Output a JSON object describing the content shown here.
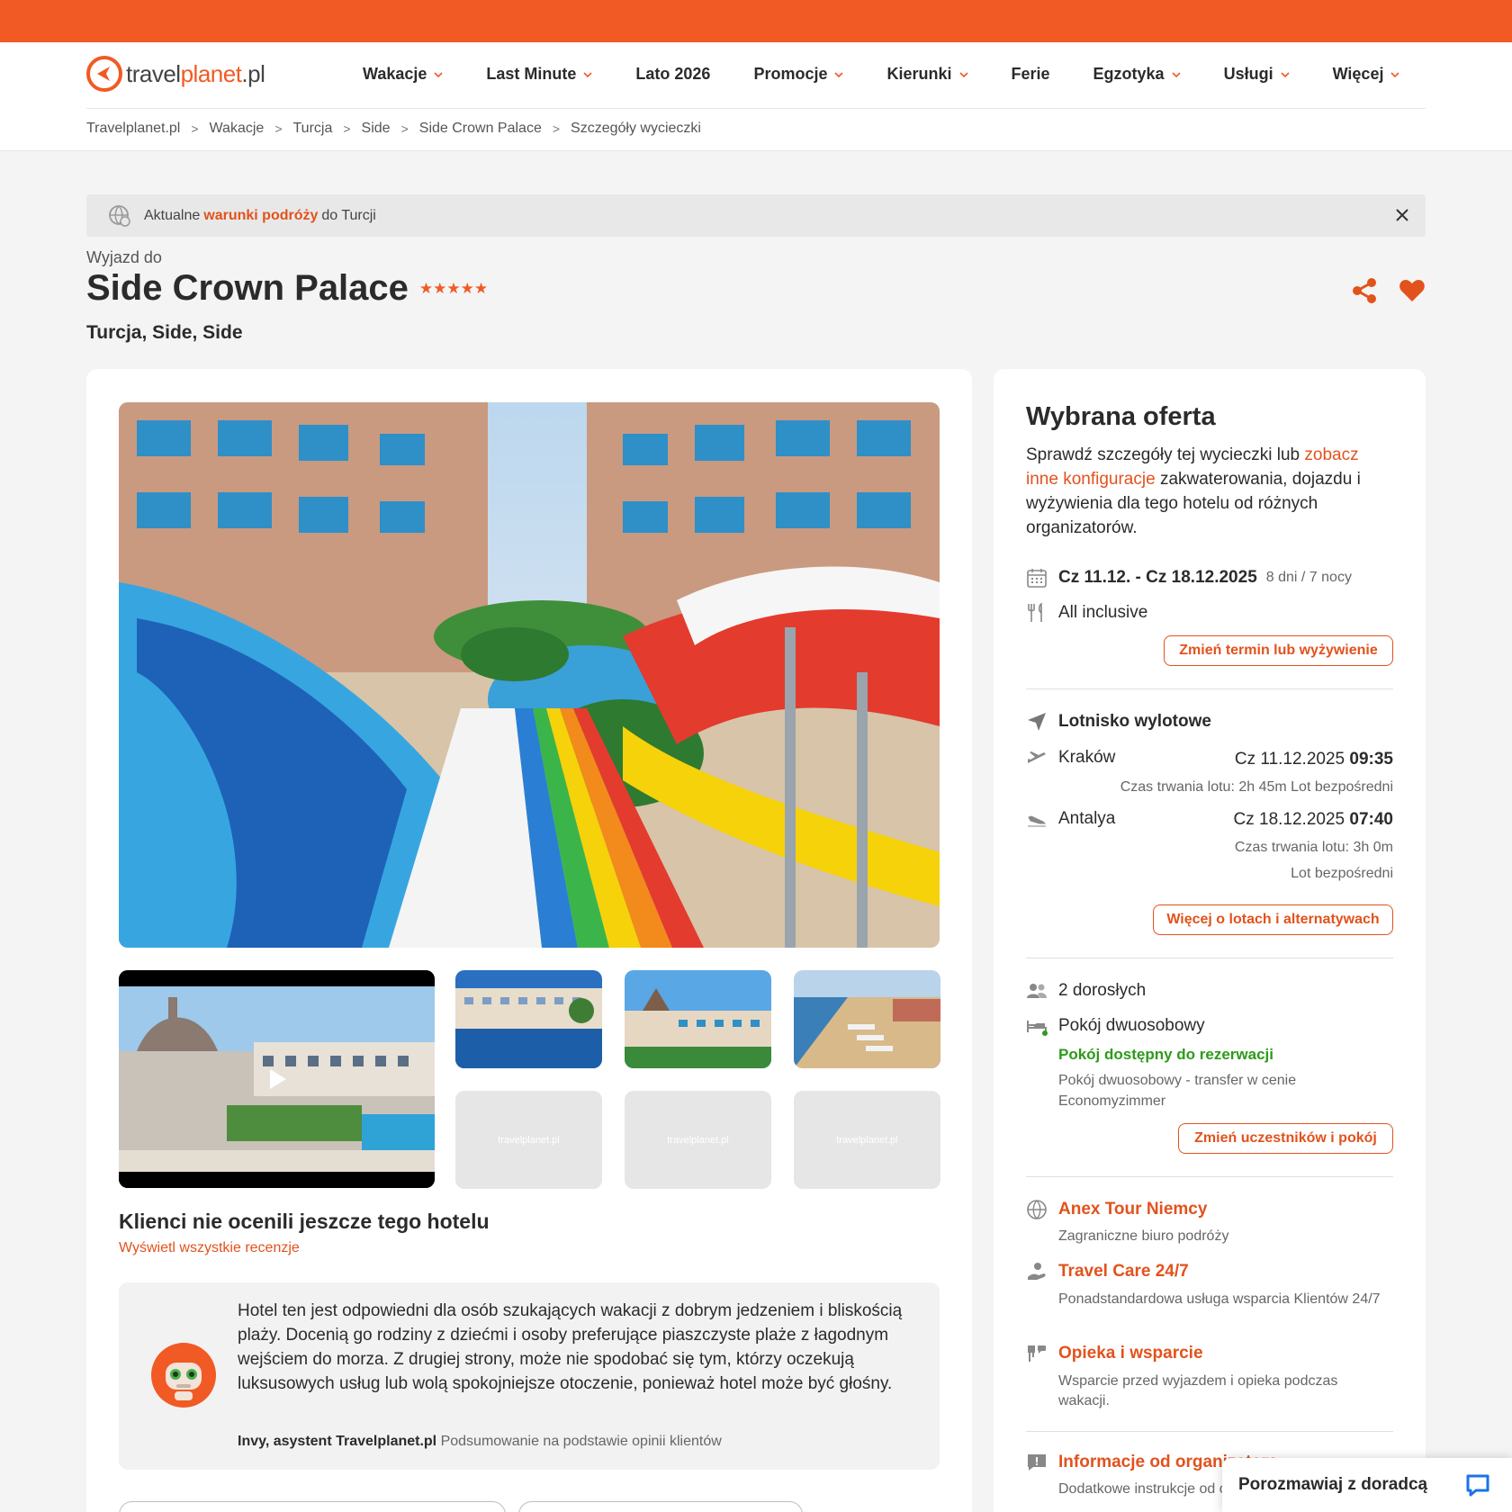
{
  "logo": {
    "part1": "travel",
    "part2": "planet",
    "part3": ".pl"
  },
  "nav": [
    {
      "label": "Wakacje",
      "dropdown": true
    },
    {
      "label": "Last Minute",
      "dropdown": true
    },
    {
      "label": "Lato 2026",
      "dropdown": false
    },
    {
      "label": "Promocje",
      "dropdown": true
    },
    {
      "label": "Kierunki",
      "dropdown": true
    },
    {
      "label": "Ferie",
      "dropdown": false
    },
    {
      "label": "Egzotyka",
      "dropdown": true
    },
    {
      "label": "Usługi",
      "dropdown": true
    },
    {
      "label": "Więcej",
      "dropdown": true
    }
  ],
  "breadcrumb": [
    "Travelplanet.pl",
    "Wakacje",
    "Turcja",
    "Side",
    "Side Crown Palace",
    "Szczegóły wycieczki"
  ],
  "notice": {
    "prefix": "Aktualne",
    "link": "warunki podróży",
    "suffix": "do Turcji"
  },
  "hotel": {
    "pre_title": "Wyjazd do",
    "name": "Side Crown Palace",
    "stars": "★★★★★",
    "location": "Turcja, Side, Side"
  },
  "reviews": {
    "title": "Klienci nie ocenili jeszcze tego hotelu",
    "link": "Wyświetl wszystkie recenzje"
  },
  "ai_summary": {
    "text": "Hotel ten jest odpowiedni dla osób szukających wakacji z dobrym jedzeniem i bliskością plaży. Docenią go rodziny z dziećmi i osoby preferujące piaszczyste plaże z łagodnym wejściem do morza. Z drugiej strony, może nie spodobać się tym, którzy oczekują luksusowych usług lub wolą spokojniejsze otoczenie, ponieważ hotel może być głośny.",
    "author": "Invy, asystent Travelplanet.pl",
    "note": "Podsumowanie na podstawie opinii klientów"
  },
  "thumb_placeholder": "travelplanet.pl",
  "offer": {
    "title": "Wybrana oferta",
    "desc_1": "Sprawdź szczegóły tej wycieczki lub",
    "desc_link": "zobacz inne konfiguracje",
    "desc_2": "zakwaterowania, dojazdu i wyżywienia dla tego hotelu od różnych organizatorów.",
    "dates": "Cz 11.12. - Cz 18.12.2025",
    "duration": "8 dni / 7 nocy",
    "board": "All inclusive",
    "btn_change_term": "Zmień termin lub wyżywienie",
    "airport_title": "Lotnisko wylotowe",
    "out_city": "Kraków",
    "out_date": "Cz 11.12.2025",
    "out_time": "09:35",
    "out_info": "Czas trwania lotu: 2h 45m  Lot bezpośredni",
    "ret_city": "Antalya",
    "ret_date": "Cz 18.12.2025",
    "ret_time": "07:40",
    "ret_info": "Czas trwania lotu: 3h 0m",
    "ret_info2": "Lot bezpośredni",
    "btn_flights": "Więcej o lotach i alternatywach",
    "adults": "2 dorosłych",
    "room": "Pokój dwuosobowy",
    "room_status": "Pokój dostępny do rezerwacji",
    "room_desc": "Pokój dwuosobowy - transfer w cenie Economyzimmer",
    "btn_room": "Zmień uczestników i pokój",
    "operator": "Anex Tour Niemcy",
    "operator_desc": "Zagraniczne biuro podróży",
    "care": "Travel Care 24/7",
    "care_desc": "Ponadstandardowa usługa wsparcia Klientów 24/7",
    "support": "Opieka i wsparcie",
    "support_desc": "Wsparcie przed wyjazdem i opieka podczas wakacji.",
    "info": "Informacje od organizatora",
    "info_desc": "Dodatkowe instrukcje od organizatora"
  },
  "chat": {
    "label": "Porozmawiaj z doradcą"
  },
  "colors": {
    "accent": "#f15a24",
    "link": "#e2521d",
    "green": "#2e9a1a"
  }
}
